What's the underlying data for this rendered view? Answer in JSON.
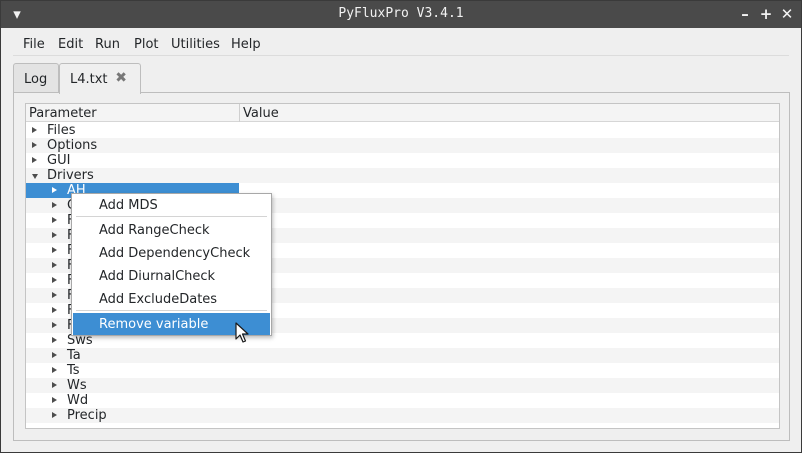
{
  "window": {
    "title": "PyFluxPro V3.4.1"
  },
  "titlebar_controls": {
    "menu": "▾",
    "minimize": "–",
    "maximize": "+",
    "close": "✕"
  },
  "menubar": [
    "File",
    "Edit",
    "Run",
    "Plot",
    "Utilities",
    "Help"
  ],
  "tabs": [
    {
      "label": "Log",
      "active": false
    },
    {
      "label": "L4.txt",
      "active": true,
      "closable": true,
      "close_glyph": "✖"
    }
  ],
  "tree": {
    "columns": [
      "Parameter",
      "Value"
    ],
    "rows": [
      {
        "label": "Files",
        "level": 0,
        "expanded": false
      },
      {
        "label": "Options",
        "level": 0,
        "expanded": false
      },
      {
        "label": "GUI",
        "level": 0,
        "expanded": false
      },
      {
        "label": "Drivers",
        "level": 0,
        "expanded": true
      },
      {
        "label": "AH",
        "level": 1,
        "expanded": false,
        "selected": true
      },
      {
        "label": "C",
        "level": 1,
        "expanded": false
      },
      {
        "label": "F",
        "level": 1,
        "expanded": false
      },
      {
        "label": "F",
        "level": 1,
        "expanded": false
      },
      {
        "label": "F",
        "level": 1,
        "expanded": false
      },
      {
        "label": "F",
        "level": 1,
        "expanded": false
      },
      {
        "label": "F",
        "level": 1,
        "expanded": false
      },
      {
        "label": "F",
        "level": 1,
        "expanded": false
      },
      {
        "label": "F",
        "level": 1,
        "expanded": false
      },
      {
        "label": "F",
        "level": 1,
        "expanded": false
      },
      {
        "label": "Sws",
        "level": 1,
        "expanded": false
      },
      {
        "label": "Ta",
        "level": 1,
        "expanded": false
      },
      {
        "label": "Ts",
        "level": 1,
        "expanded": false
      },
      {
        "label": "Ws",
        "level": 1,
        "expanded": false
      },
      {
        "label": "Wd",
        "level": 1,
        "expanded": false
      },
      {
        "label": "Precip",
        "level": 1,
        "expanded": false
      }
    ]
  },
  "context_menu": {
    "items": [
      {
        "label": "Add MDS",
        "separator_after": true
      },
      {
        "label": "Add RangeCheck"
      },
      {
        "label": "Add DependencyCheck"
      },
      {
        "label": "Add DiurnalCheck"
      },
      {
        "label": "Add ExcludeDates",
        "separator_after": true
      },
      {
        "label": "Remove variable",
        "highlighted": true
      }
    ]
  },
  "colors": {
    "titlebar": "#4a4a4a",
    "selection": "#3d8ed3",
    "window_bg": "#efefef"
  }
}
